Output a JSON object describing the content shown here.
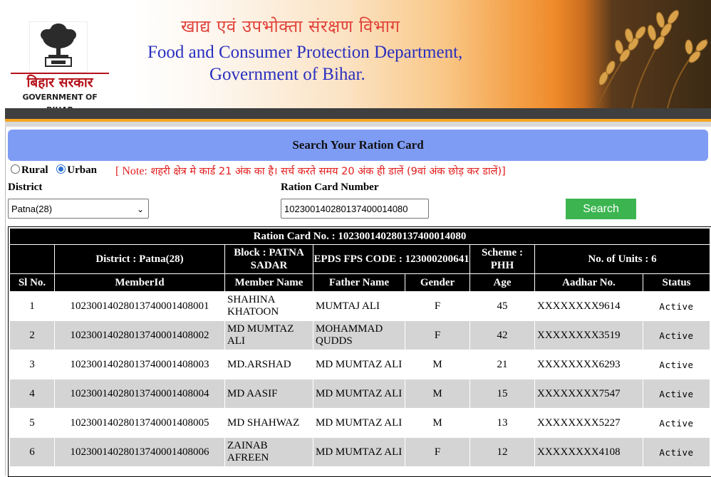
{
  "header": {
    "logo_hi": "बिहार सरकार",
    "logo_en": "GOVERNMENT OF BIHAR",
    "dept_hi": "खाद्य एवं उपभोक्ता संरक्षण विभाग",
    "dept_en_line1": "Food and Consumer Protection Department,",
    "dept_en_line2": "Government of Bihar."
  },
  "search": {
    "title": "Search Your Ration Card",
    "area_options": [
      {
        "label": "Rural",
        "selected": false
      },
      {
        "label": "Urban",
        "selected": true
      }
    ],
    "note_prefix": "[ Note:",
    "note_text": " शहरी क्षेत्र मे कार्ड 21 अंक का है। सर्च करते समय 20 अंक ही डालें (9वां अंक छोड़ कर डालें)]",
    "district_label": "District",
    "district_value": "Patna(28)",
    "card_label": "Ration Card Number",
    "card_value": "10230014028013740001408​0",
    "button_label": "Search"
  },
  "result": {
    "ration_card_caption": "Ration Card No. : 102300140280137400014080",
    "district": "District : Patna(28)",
    "block": "Block : PATNA SADAR",
    "epds": "EPDS FPS CODE : 123000200641",
    "scheme": "Scheme : PHH",
    "units": "No. of Units : 6",
    "columns": [
      "Sl No.",
      "MemberId",
      "Member Name",
      "Father Name",
      "Gender",
      "Age",
      "Aadhar No.",
      "Status"
    ],
    "rows": [
      {
        "sl": "1",
        "member_id": "102300140280137400014080​01",
        "name": "SHAHINA KHATOON",
        "father": "MUMTAJ ALI",
        "gender": "F",
        "age": "45",
        "aadhar": "XXXXXXXX9614",
        "status": "Active"
      },
      {
        "sl": "2",
        "member_id": "102300140280137400014080​02",
        "name": "MD MUMTAZ ALI",
        "father": "MOHAMMAD QUDDS",
        "gender": "F",
        "age": "42",
        "aadhar": "XXXXXXXX3519",
        "status": "Active"
      },
      {
        "sl": "3",
        "member_id": "102300140280137400014080​03",
        "name": "MD.ARSHAD",
        "father": "MD MUMTAZ ALI",
        "gender": "M",
        "age": "21",
        "aadhar": "XXXXXXXX6293",
        "status": "Active"
      },
      {
        "sl": "4",
        "member_id": "102300140280137400014080​04",
        "name": "MD AASIF",
        "father": "MD MUMTAZ ALI",
        "gender": "M",
        "age": "15",
        "aadhar": "XXXXXXXX7547",
        "status": "Active"
      },
      {
        "sl": "5",
        "member_id": "102300140280137400014080​05",
        "name": "MD SHAHWAZ",
        "father": "MD MUMTAZ ALI",
        "gender": "M",
        "age": "13",
        "aadhar": "XXXXXXXX5227",
        "status": "Active"
      },
      {
        "sl": "6",
        "member_id": "102300140280137400014080​06",
        "name": "ZAINAB AFREEN",
        "father": "MD MUMTAZ ALI",
        "gender": "F",
        "age": "12",
        "aadhar": "XXXXXXXX4108",
        "status": "Active"
      }
    ]
  },
  "colors": {
    "search_header": "#7f9cf5",
    "search_button": "#3cb550",
    "note": "#e11b1b",
    "dept_en": "#2a2fbf",
    "dept_hi": "#e0433a"
  }
}
